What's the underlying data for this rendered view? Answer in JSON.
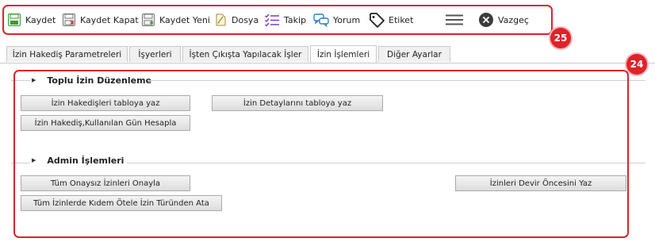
{
  "toolbar": {
    "items": [
      {
        "label": "Kaydet",
        "icon": "save-icon"
      },
      {
        "label": "Kaydet Kapat",
        "icon": "save-close-icon"
      },
      {
        "label": "Kaydet Yeni",
        "icon": "save-new-icon"
      },
      {
        "label": "Dosya",
        "icon": "file-icon"
      },
      {
        "label": "Takip",
        "icon": "checklist-icon"
      },
      {
        "label": "Yorum",
        "icon": "comment-icon"
      },
      {
        "label": "Etiket",
        "icon": "tag-icon"
      },
      {
        "label": "",
        "icon": "hamburger-menu-icon"
      },
      {
        "label": "Vazgeç",
        "icon": "cancel-icon"
      }
    ],
    "callout_number": "25"
  },
  "tabs": [
    {
      "label": "İzin Hakediş Parametreleri",
      "active": false
    },
    {
      "label": "İşyerleri",
      "active": false
    },
    {
      "label": "İşten Çıkışta Yapılacak İşler",
      "active": false
    },
    {
      "label": "İzin İşlemleri",
      "active": true
    },
    {
      "label": "Diğer Ayarlar",
      "active": false
    }
  ],
  "sections": {
    "toplu": {
      "title": "Toplu İzin Düzenleme",
      "buttons": [
        "İzin Hakedişleri tabloya yaz",
        "İzin Detaylarını tabloya yaz",
        "İzin Hakediş,Kullanılan Gün Hesapla"
      ]
    },
    "admin": {
      "title": "Admin İşlemleri",
      "buttons": [
        "Tüm Onaysız İzinleri Onayla",
        "İzinleri Devir Öncesini Yaz",
        "Tüm İzinlerde Kıdem Ötele İzin Türünden Ata"
      ]
    }
  },
  "content_callout_number": "24",
  "colors": {
    "callout": "#e0222a",
    "save_green": "#3a9a3a",
    "purple": "#7a3fb0",
    "blue": "#2a7fc4"
  }
}
